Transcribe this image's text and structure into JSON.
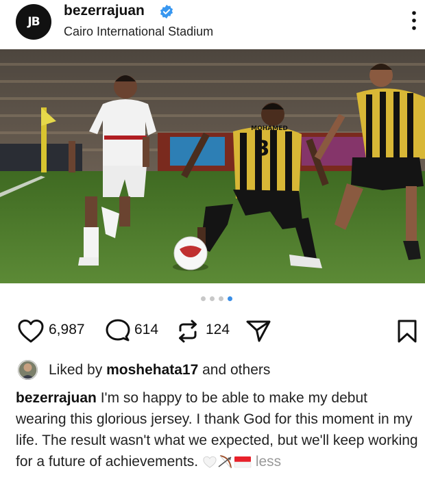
{
  "post": {
    "username": "bezerrajuan",
    "location": "Cairo International Stadium",
    "avatar_text": "JB",
    "verified": true
  },
  "image": {
    "jersey_number": "3",
    "jersey_name": "MOHAMED"
  },
  "carousel": {
    "count": 4,
    "active_index": 3
  },
  "actions": {
    "likes": "6,987",
    "comments": "614",
    "reposts": "124",
    "icons": [
      "heart-icon",
      "comment-icon",
      "repost-icon",
      "share-icon",
      "bookmark-icon"
    ]
  },
  "liked_by": {
    "prefix": "Liked by ",
    "user": "moshehata17",
    "suffix": " and others"
  },
  "caption": {
    "username": "bezerrajuan",
    "text": " I'm so happy to be able to make my debut wearing this glorious jersey. I thank God for this moment in my life. The result wasn't what we expected, but we'll keep working for a future of achievements. ",
    "emojis": [
      "white-heart-emoji",
      "archery-emoji",
      "indonesia-flag-emoji"
    ],
    "less_label": "less"
  },
  "colors": {
    "verified": "#3897f0",
    "active_dot": "#3a8ee6",
    "pitch": "#4f7a2c"
  }
}
